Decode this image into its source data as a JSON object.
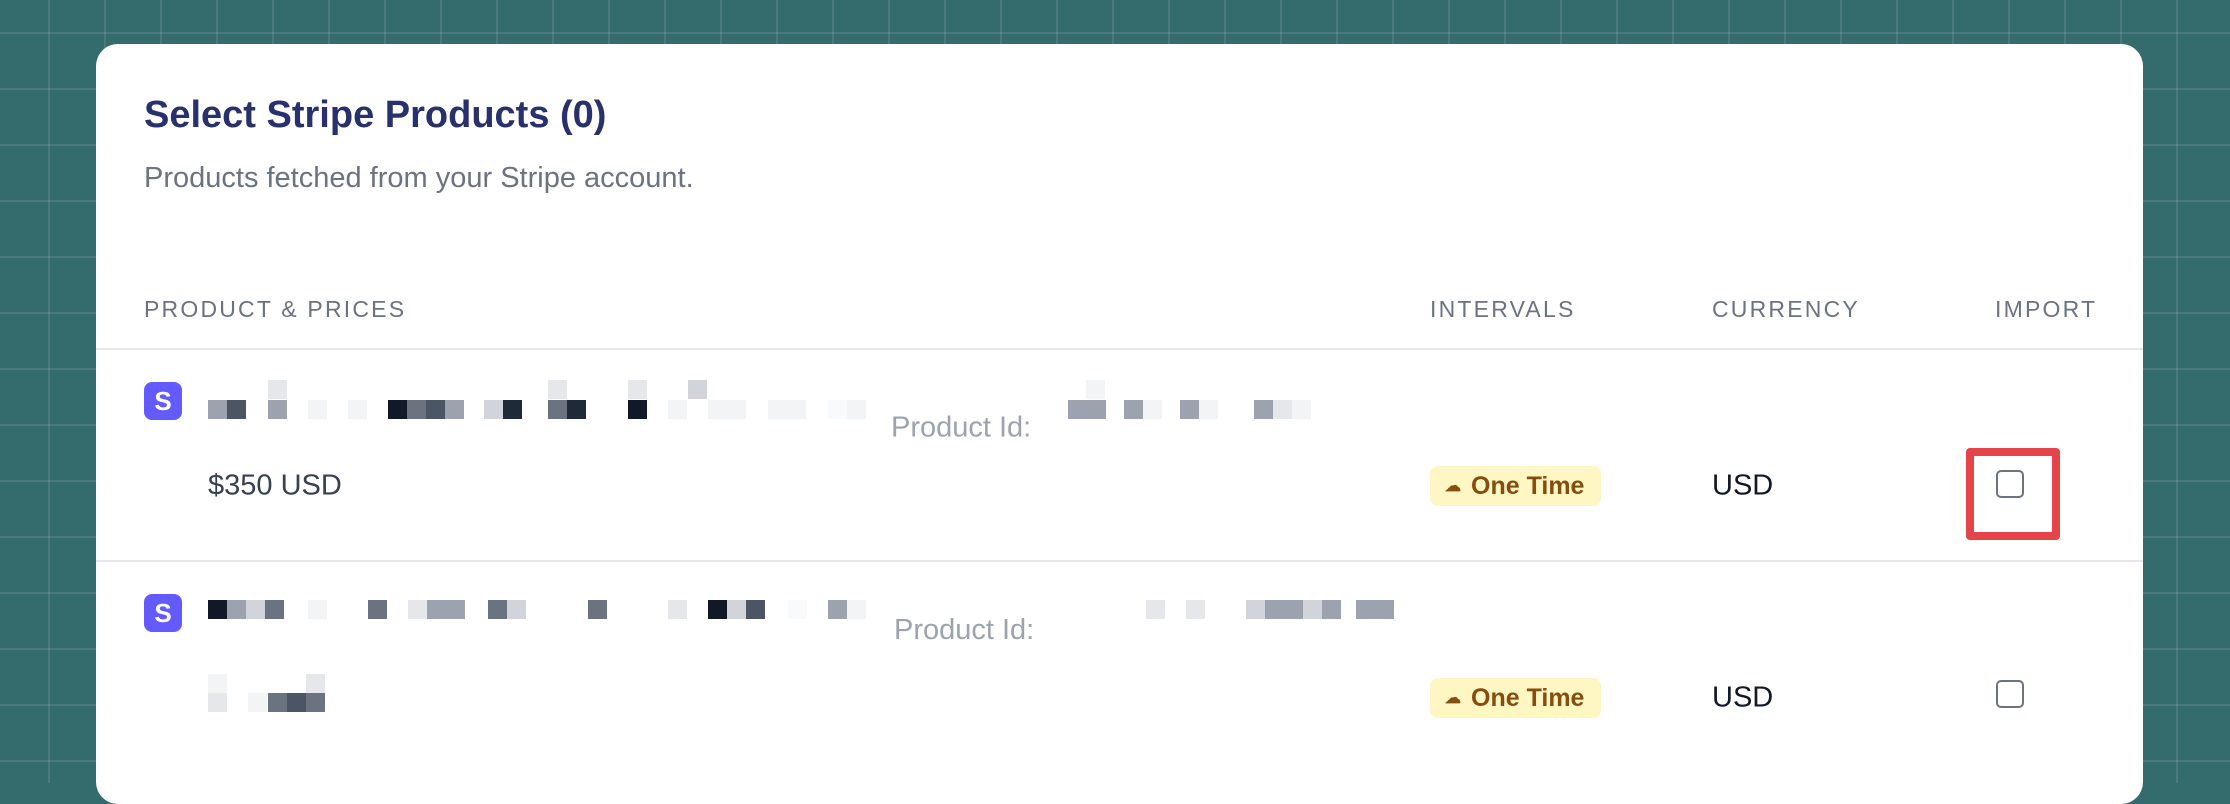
{
  "panel": {
    "title": "Select Stripe Products (0)",
    "subtitle": "Products fetched from your Stripe account."
  },
  "table": {
    "columns": {
      "product": "PRODUCT & PRICES",
      "intervals": "INTERVALS",
      "currency": "CURRENCY",
      "import": "IMPORT"
    },
    "rows": [
      {
        "logo": "S",
        "product_id_label": "Product Id:",
        "price": "$350 USD",
        "interval": "One Time",
        "interval_icon": "cloud-icon",
        "currency": "USD",
        "import_checked": false,
        "highlighted": true
      },
      {
        "logo": "S",
        "product_id_label": "Product Id:",
        "price": "",
        "interval": "One Time",
        "interval_icon": "cloud-icon",
        "currency": "USD",
        "import_checked": false,
        "highlighted": false
      }
    ]
  },
  "colors": {
    "background": "#346c6e",
    "title": "#28316b",
    "stripe_brand": "#635bff",
    "badge_bg": "#fef7c3",
    "badge_text": "#854d0e",
    "highlight": "#e5444a"
  }
}
